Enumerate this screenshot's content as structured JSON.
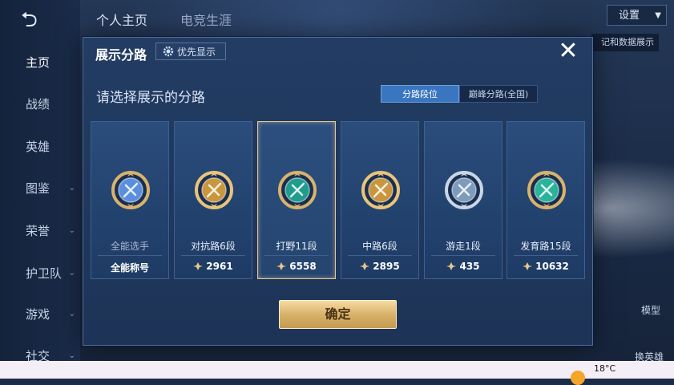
{
  "background": {
    "back_label": "⮌",
    "top_tabs": [
      "个人主页",
      "电竞生涯"
    ],
    "settings_label": "设置",
    "data_chip_label": "记和数据展示",
    "nav_items": [
      {
        "label": "主页",
        "active": true,
        "has_caret": false
      },
      {
        "label": "战绩",
        "active": false,
        "has_caret": false
      },
      {
        "label": "英雄",
        "active": false,
        "has_caret": false
      },
      {
        "label": "图鉴",
        "active": false,
        "has_caret": true
      },
      {
        "label": "荣誉",
        "active": false,
        "has_caret": true
      },
      {
        "label": "护卫队",
        "active": false,
        "has_caret": true
      },
      {
        "label": "游戏",
        "active": false,
        "has_caret": true
      },
      {
        "label": "社交",
        "active": false,
        "has_caret": true
      }
    ],
    "right_labels": [
      "模型",
      "换英雄"
    ]
  },
  "modal": {
    "title": "展示分路",
    "priority_label": "优先显示",
    "close_glyph": "✕",
    "subtitle": "请选择展示的分路",
    "segments": [
      {
        "label": "分路段位",
        "active": true
      },
      {
        "label": "巅峰分路(全国)",
        "active": false
      }
    ],
    "cards": [
      {
        "name": "全能选手",
        "score": "全能称号",
        "show_icon": false,
        "selected": false,
        "badge_color": "#5a8fe0",
        "ring_color": "#d7b36e"
      },
      {
        "name": "对抗路6段",
        "score": "2961",
        "show_icon": true,
        "selected": false,
        "badge_color": "#c9963e",
        "ring_color": "#e9c47b"
      },
      {
        "name": "打野11段",
        "score": "6558",
        "show_icon": true,
        "selected": true,
        "badge_color": "#1f9c8e",
        "ring_color": "#d7b36e"
      },
      {
        "name": "中路6段",
        "score": "2895",
        "show_icon": true,
        "selected": false,
        "badge_color": "#c9963e",
        "ring_color": "#e9c47b"
      },
      {
        "name": "游走1段",
        "score": "435",
        "show_icon": true,
        "selected": false,
        "badge_color": "#7d9bbd",
        "ring_color": "#c9d6e6"
      },
      {
        "name": "发育路15段",
        "score": "10632",
        "show_icon": true,
        "selected": false,
        "badge_color": "#2ab39b",
        "ring_color": "#d7b36e"
      }
    ],
    "confirm_label": "确定"
  },
  "taskbar": {
    "temperature": "18°C"
  },
  "colors": {
    "accent_gold": "#d9b26a",
    "panel_blue": "#223c63",
    "active_tab": "#3a76c0"
  }
}
